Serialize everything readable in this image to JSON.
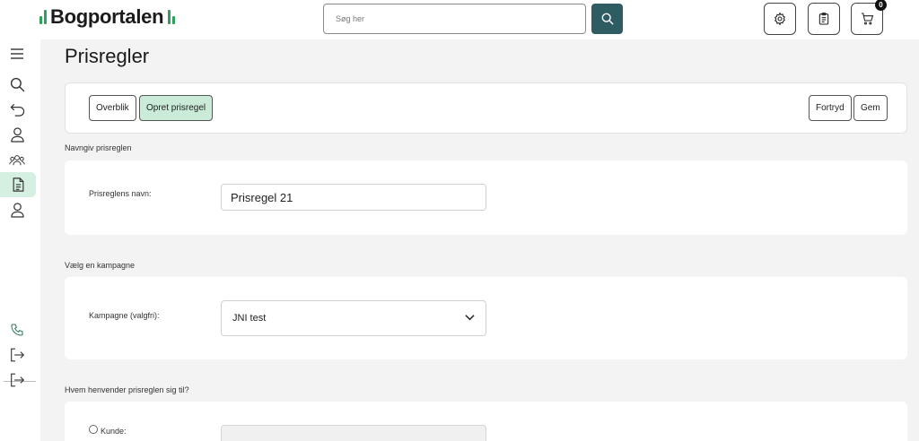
{
  "header": {
    "logo": "Bogportalen",
    "search": {
      "placeholder": "Søg her",
      "value": ""
    },
    "cart_count": "0"
  },
  "page": {
    "title": "Prisregler"
  },
  "toolbar": {
    "overview_label": "Overblik",
    "create_label": "Opret prisregel",
    "cancel_label": "Fortryd",
    "save_label": "Gem"
  },
  "sections": {
    "name": {
      "heading": "Navngiv prisreglen",
      "field_label": "Prisreglens navn:",
      "value": "Prisregel 21"
    },
    "campaign": {
      "heading": "Vælg en kampagne",
      "field_label": "Kampagne (valgfri):",
      "selected": "JNI test"
    },
    "audience": {
      "heading": "Hvem henvender prisreglen sig til?",
      "option_label": "Kunde:"
    }
  },
  "colors": {
    "accent": "#2e5c62",
    "active_bg": "#c9ebd8",
    "logo_green": "#2f9e5f"
  },
  "icons": {
    "sidebar": [
      "menu-icon",
      "search-icon",
      "undo-icon",
      "user-icon",
      "users-icon",
      "document-icon",
      "user-icon",
      "phone-icon",
      "logout-icon",
      "logout-icon"
    ],
    "header": [
      "search-icon",
      "gear-icon",
      "clipboard-icon",
      "cart-icon"
    ]
  }
}
